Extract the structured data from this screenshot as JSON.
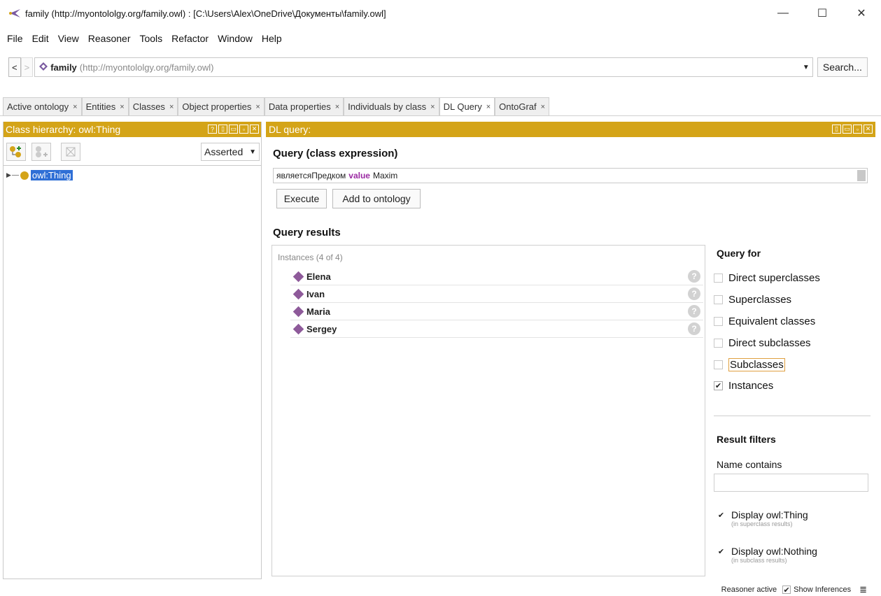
{
  "window": {
    "title": "family (http://myontololgy.org/family.owl)  : [C:\\Users\\Alex\\OneDrive\\Документы\\family.owl]",
    "minimize": "—",
    "maximize": "☐",
    "close": "✕"
  },
  "menu": [
    "File",
    "Edit",
    "View",
    "Reasoner",
    "Tools",
    "Refactor",
    "Window",
    "Help"
  ],
  "address": {
    "back": "<",
    "forward": ">",
    "ontology_name": "family",
    "ontology_iri": "(http://myontololgy.org/family.owl)",
    "search": "Search..."
  },
  "tabs": [
    {
      "label": "Active ontology",
      "close": "×"
    },
    {
      "label": "Entities",
      "close": "×"
    },
    {
      "label": "Classes",
      "close": "×"
    },
    {
      "label": "Object properties",
      "close": "×"
    },
    {
      "label": "Data properties",
      "close": "×"
    },
    {
      "label": "Individuals by class",
      "close": "×"
    },
    {
      "label": "DL Query",
      "close": "×",
      "active": true
    },
    {
      "label": "OntoGraf",
      "close": "×"
    }
  ],
  "left": {
    "header": "Class hierarchy: owl:Thing",
    "asserted": "Asserted",
    "tree_root": "owl:Thing"
  },
  "right": {
    "header": "DL query:",
    "query_title": "Query (class expression)",
    "query_prefix": "являетсяПредком",
    "query_keyword": "value",
    "query_suffix": "Maxim",
    "execute": "Execute",
    "add_to_ontology": "Add to ontology",
    "results_title": "Query results",
    "instances_header": "Instances (4 of 4)",
    "instances": [
      "Elena",
      "Ivan",
      "Maria",
      "Sergey"
    ],
    "help_glyph": "?",
    "query_for_title": "Query for",
    "query_for": [
      {
        "label": "Direct superclasses",
        "checked": false
      },
      {
        "label": "Superclasses",
        "checked": false
      },
      {
        "label": "Equivalent classes",
        "checked": false
      },
      {
        "label": "Direct subclasses",
        "checked": false
      },
      {
        "label": "Subclasses",
        "checked": false
      },
      {
        "label": "Instances",
        "checked": true
      }
    ],
    "result_filters_title": "Result filters",
    "name_contains": "Name contains",
    "display_thing": "Display owl:Thing",
    "display_thing_note": "(in superclass results)",
    "display_nothing": "Display owl:Nothing",
    "display_nothing_note": "(in subclass results)"
  },
  "status": {
    "reasoner": "Reasoner active",
    "show_inferences": "Show Inferences"
  },
  "colors": {
    "header_gold": "#d4a418",
    "selection_blue": "#2f6fd6",
    "individual_purple": "#8e5a9a",
    "keyword_purple": "#9b2aa3"
  }
}
